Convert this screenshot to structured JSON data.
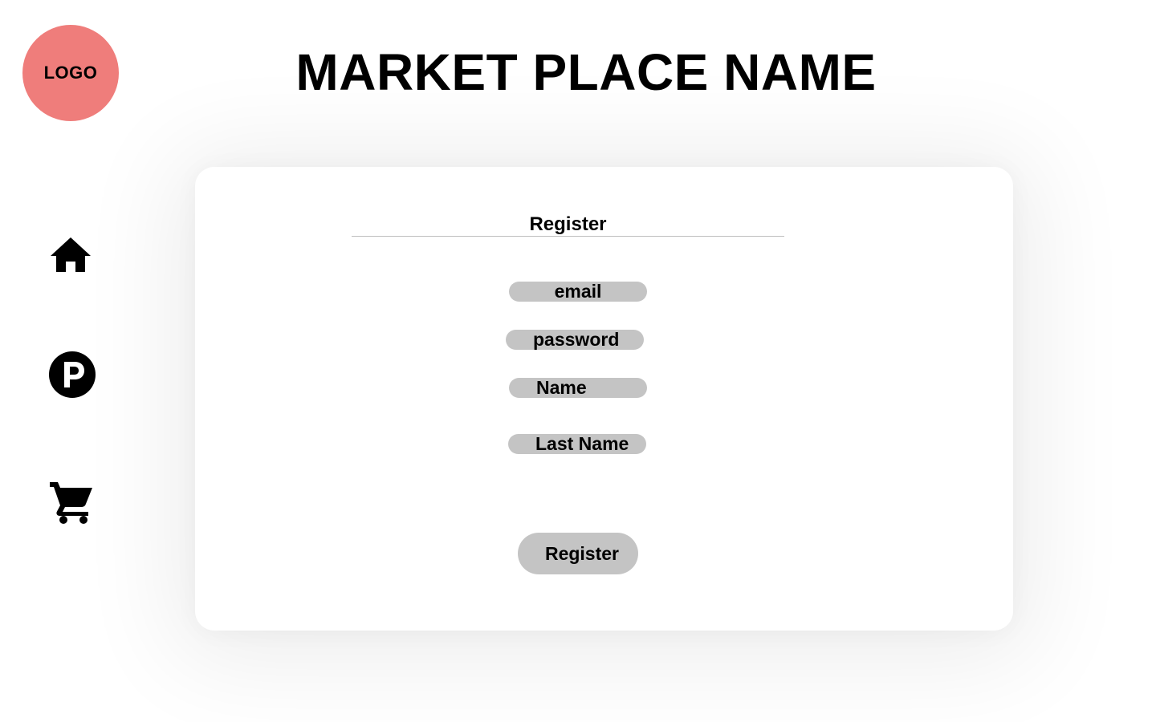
{
  "logo": {
    "label": "LOGO"
  },
  "header": {
    "title": "MARKET PLACE NAME"
  },
  "sidebar": {
    "items": [
      {
        "icon": "home-icon"
      },
      {
        "icon": "p-circle-icon"
      },
      {
        "icon": "shopping-cart-icon"
      }
    ]
  },
  "form": {
    "heading": "Register",
    "fields": {
      "email": "email",
      "password": "password",
      "name": "Name",
      "last_name": "Last Name"
    },
    "submit_label": "Register"
  },
  "colors": {
    "logo_bg": "#ef7d7b",
    "field_bg": "#c4c4c4",
    "icon": "#000000"
  }
}
